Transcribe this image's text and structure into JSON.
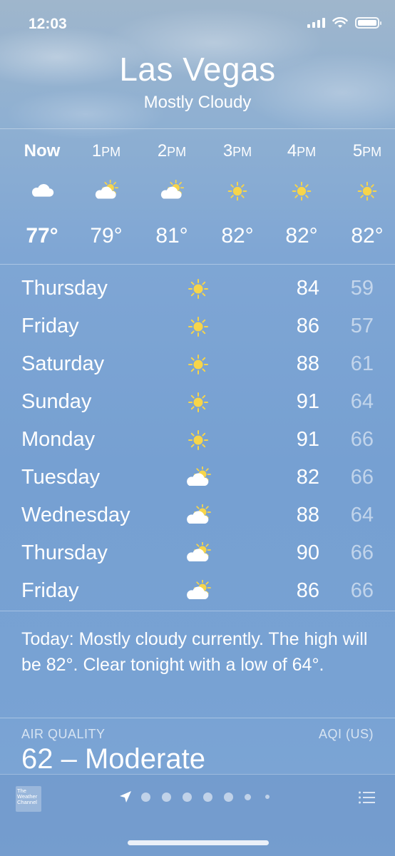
{
  "status_bar": {
    "time": "12:03"
  },
  "header": {
    "city": "Las Vegas",
    "condition": "Mostly Cloudy"
  },
  "hourly": [
    {
      "label": "Now",
      "suffix": "",
      "icon": "cloud-icon",
      "temp": "77°"
    },
    {
      "label": "1",
      "suffix": "PM",
      "icon": "partly-sunny-icon",
      "temp": "79°"
    },
    {
      "label": "2",
      "suffix": "PM",
      "icon": "partly-sunny-icon",
      "temp": "81°"
    },
    {
      "label": "3",
      "suffix": "PM",
      "icon": "sun-icon",
      "temp": "82°"
    },
    {
      "label": "4",
      "suffix": "PM",
      "icon": "sun-icon",
      "temp": "82°"
    },
    {
      "label": "5",
      "suffix": "PM",
      "icon": "sun-icon",
      "temp": "82°"
    }
  ],
  "daily": [
    {
      "day": "Thursday",
      "icon": "sun-icon",
      "high": "84",
      "low": "59"
    },
    {
      "day": "Friday",
      "icon": "sun-icon",
      "high": "86",
      "low": "57"
    },
    {
      "day": "Saturday",
      "icon": "sun-icon",
      "high": "88",
      "low": "61"
    },
    {
      "day": "Sunday",
      "icon": "sun-icon",
      "high": "91",
      "low": "64"
    },
    {
      "day": "Monday",
      "icon": "sun-icon",
      "high": "91",
      "low": "66"
    },
    {
      "day": "Tuesday",
      "icon": "partly-sunny-icon",
      "high": "82",
      "low": "66"
    },
    {
      "day": "Wednesday",
      "icon": "partly-sunny-icon",
      "high": "88",
      "low": "64"
    },
    {
      "day": "Thursday",
      "icon": "partly-sunny-icon",
      "high": "90",
      "low": "66"
    },
    {
      "day": "Friday",
      "icon": "partly-sunny-icon",
      "high": "86",
      "low": "66"
    }
  ],
  "summary": "Today: Mostly cloudy currently. The high will be 82°. Clear tonight with a low of 64°.",
  "air_quality": {
    "label": "AIR QUALITY",
    "unit": "AQI (US)",
    "value": "62 – Moderate"
  },
  "footer": {
    "logo_lines": [
      "The",
      "Weather",
      "Channel"
    ],
    "page_dots": 7
  },
  "colors": {
    "sun": "#f7d54a",
    "cloud": "#ffffff"
  }
}
